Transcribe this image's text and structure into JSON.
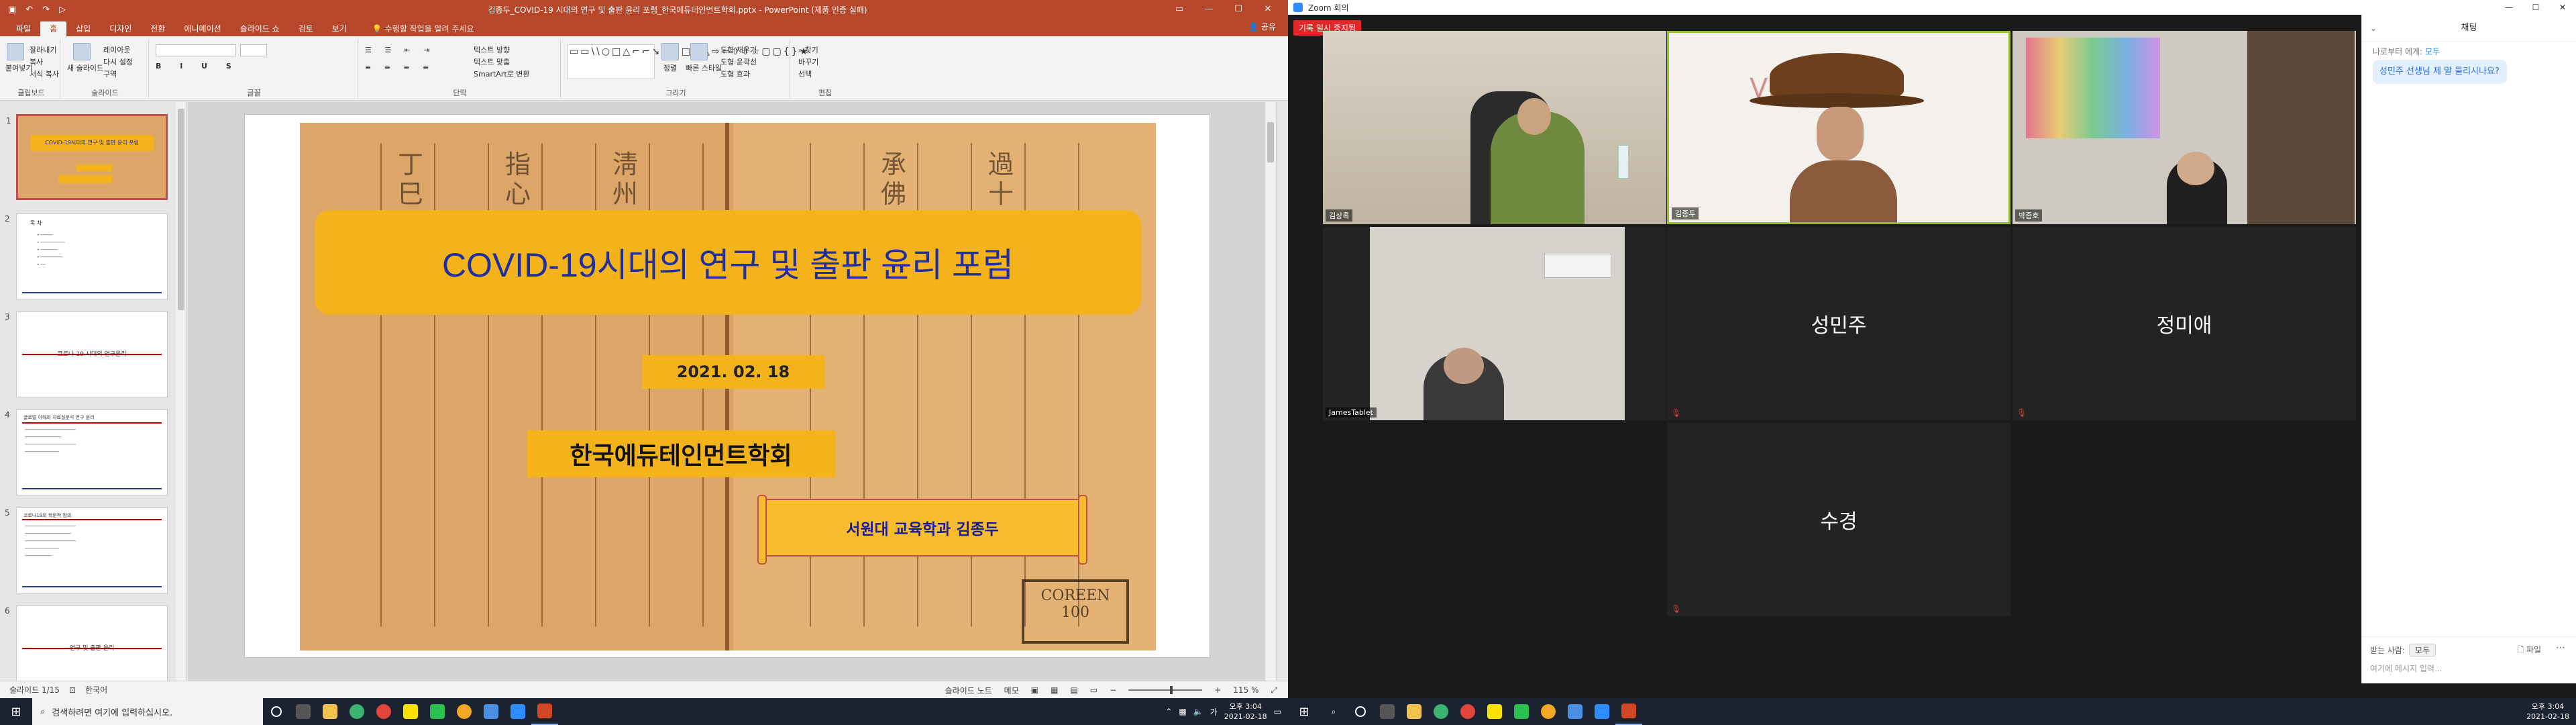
{
  "ppt": {
    "title": "김종두_COVID-19 시대의 연구 및 출판 윤리 포럼_한국에듀테인먼트학회.pptx - PowerPoint (제품 인증 실패)",
    "tabs": [
      "파일",
      "홈",
      "삽입",
      "디자인",
      "전환",
      "애니메이션",
      "슬라이드 쇼",
      "검토",
      "보기"
    ],
    "tell_me": "수행할 작업을 알려 주세요",
    "share": "공유",
    "ribbon": {
      "clipboard": "클립보드",
      "paste": "붙여넣기",
      "cut": "잘라내기",
      "copy": "복사",
      "format_painter": "서식 복사",
      "slides": "슬라이드",
      "new_slide": "새 슬라이드",
      "layout": "레이아웃",
      "reset": "다시 설정",
      "section": "구역",
      "font": "글꼴",
      "paragraph": "단락",
      "text_direction": "텍스트 방향",
      "align_text": "텍스트 맞춤",
      "smartart": "SmartArt로 변환",
      "drawing": "그리기",
      "arrange": "정렬",
      "quick_styles": "빠른 스타일",
      "shape_fill": "도형 채우기",
      "shape_outline": "도형 윤곽선",
      "shape_effects": "도형 효과",
      "editing": "편집",
      "find": "찾기",
      "replace": "바꾸기",
      "select": "선택"
    },
    "thumbnails": [
      {
        "num": "1",
        "title": "COVID-19시대의 연구 및 출판 윤리 포럼"
      },
      {
        "num": "2",
        "title": "목 차"
      },
      {
        "num": "3",
        "title": "코로나-19 시대의 연구윤리"
      },
      {
        "num": "4",
        "title": "글로벌 이해와 자료실분석 연구 윤리"
      },
      {
        "num": "5",
        "title": "코로나19의 학문적 함의"
      },
      {
        "num": "6",
        "title": "연구 및 출판 윤리"
      }
    ],
    "slide": {
      "main_title": "COVID-19시대의 연구 및 출판 윤리 포럼",
      "date": "2021. 02. 18",
      "org": "한국에듀테인먼트학회",
      "presenter": "서원대 교육학과 김종두",
      "stamp": "COREEN"
    },
    "status": {
      "slide_pos": "슬라이드 1/15",
      "language": "한국어",
      "notes": "슬라이드 노트",
      "comments": "메모",
      "zoom": "115 %"
    }
  },
  "taskbar_left": {
    "search_placeholder": "검색하려면 여기에 입력하십시오.",
    "time": "오후 3:04",
    "date": "2021-02-18"
  },
  "zoom": {
    "window_title": "Zoom 회의",
    "recording_badge": "기록 일시 중지됨",
    "participants": [
      {
        "name": "김상록",
        "video": true
      },
      {
        "name": "김종두",
        "video": true,
        "active_speaker": true
      },
      {
        "name": "박종호",
        "video": true
      },
      {
        "name": "JamesTablet",
        "video": true
      },
      {
        "name": "성민주",
        "video": false
      },
      {
        "name": "정미애",
        "video": false
      },
      {
        "name": "수경",
        "video": false
      }
    ],
    "chat": {
      "header": "채팅",
      "from_prefix": "나로부터 에게:",
      "from_target": "모두",
      "message": "성민주 선생님 제 말 들리시나요?",
      "send_to_label": "받는 사람:",
      "send_to_value": "모두",
      "file_label": "파일",
      "input_placeholder": "여기에 메시지 입력..."
    }
  },
  "taskbar_right": {
    "time": "오후 3:04",
    "date": "2021-02-18"
  },
  "colors": {
    "ppt_accent": "#b7472a",
    "slide_box": "#f5b31b",
    "title_text": "#1f2f9e",
    "zoom_active_border": "#97c11f",
    "rec_red": "#e02828"
  }
}
